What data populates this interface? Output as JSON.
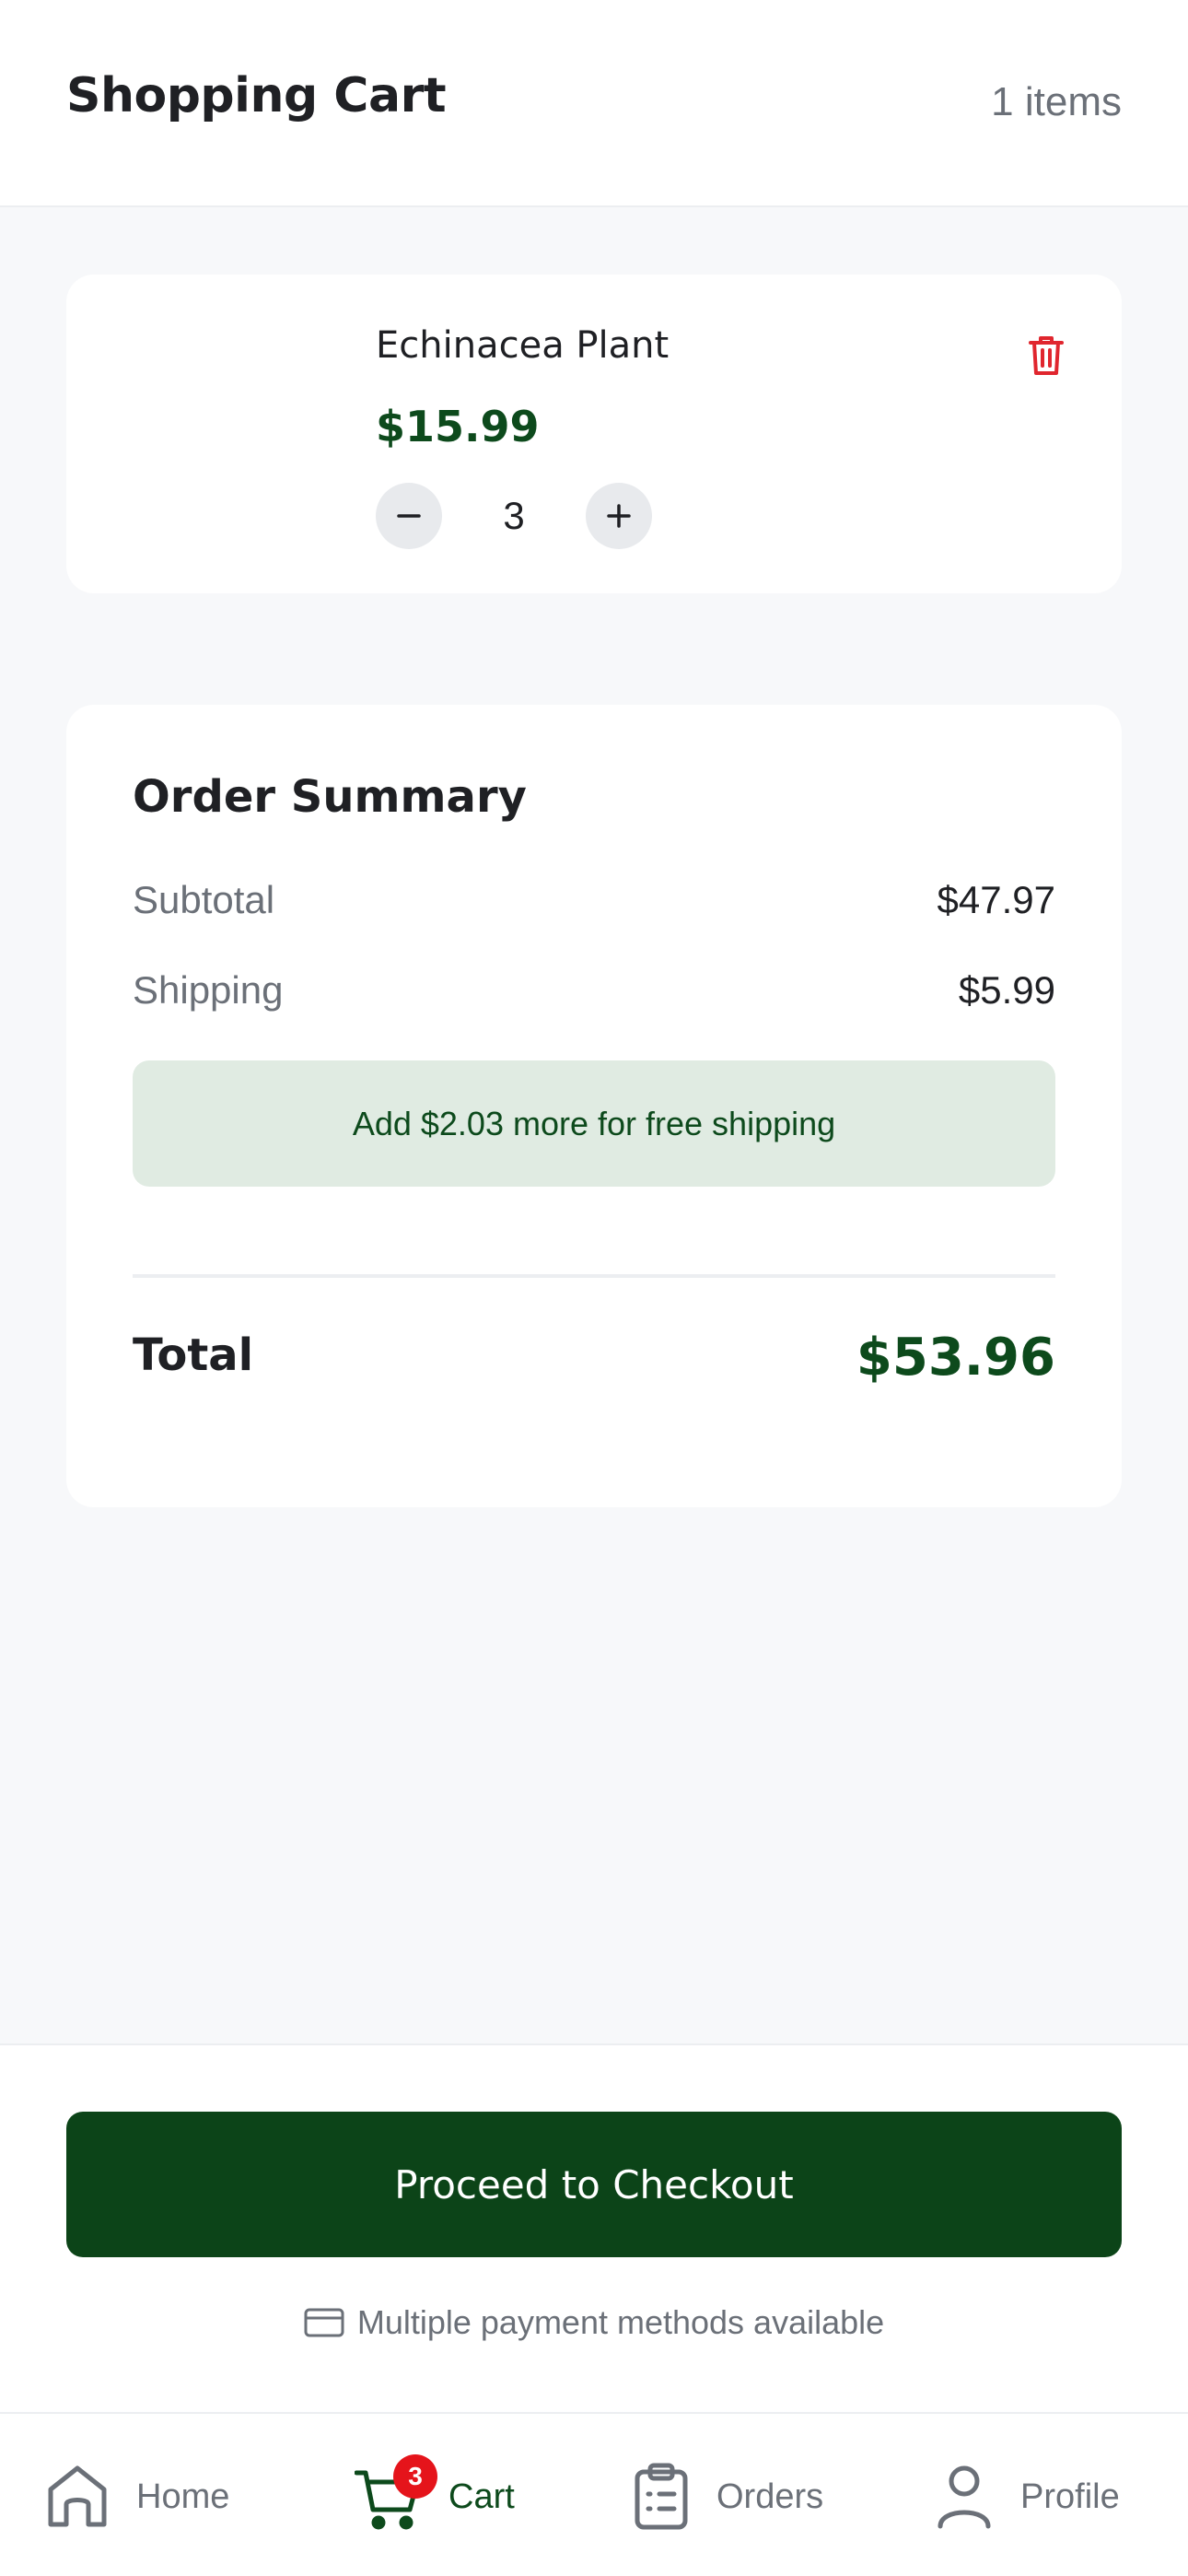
{
  "header": {
    "title": "Shopping Cart",
    "item_count": "1 items"
  },
  "cart_item": {
    "name": "Echinacea Plant",
    "price": "$15.99",
    "quantity": "3",
    "icons": {
      "delete": "trash-icon",
      "decrease": "minus-icon",
      "increase": "plus-icon"
    }
  },
  "summary": {
    "title": "Order Summary",
    "subtotal_label": "Subtotal",
    "subtotal_value": "$47.97",
    "shipping_label": "Shipping",
    "shipping_value": "$5.99",
    "free_shipping_note": "Add $2.03 more for free shipping",
    "total_label": "Total",
    "total_value": "$53.96"
  },
  "footer": {
    "checkout_label": "Proceed to Checkout",
    "payment_note": "Multiple payment methods available",
    "payment_icon": "credit-card-icon"
  },
  "tabbar": {
    "home": "Home",
    "cart": "Cart",
    "cart_badge": "3",
    "orders": "Orders",
    "profile": "Profile",
    "active": "cart"
  },
  "colors": {
    "brand_green": "#0c4418",
    "danger_red": "#e5141b",
    "banner_bg": "#e0ebe2",
    "page_bg": "#f7f8fa"
  }
}
